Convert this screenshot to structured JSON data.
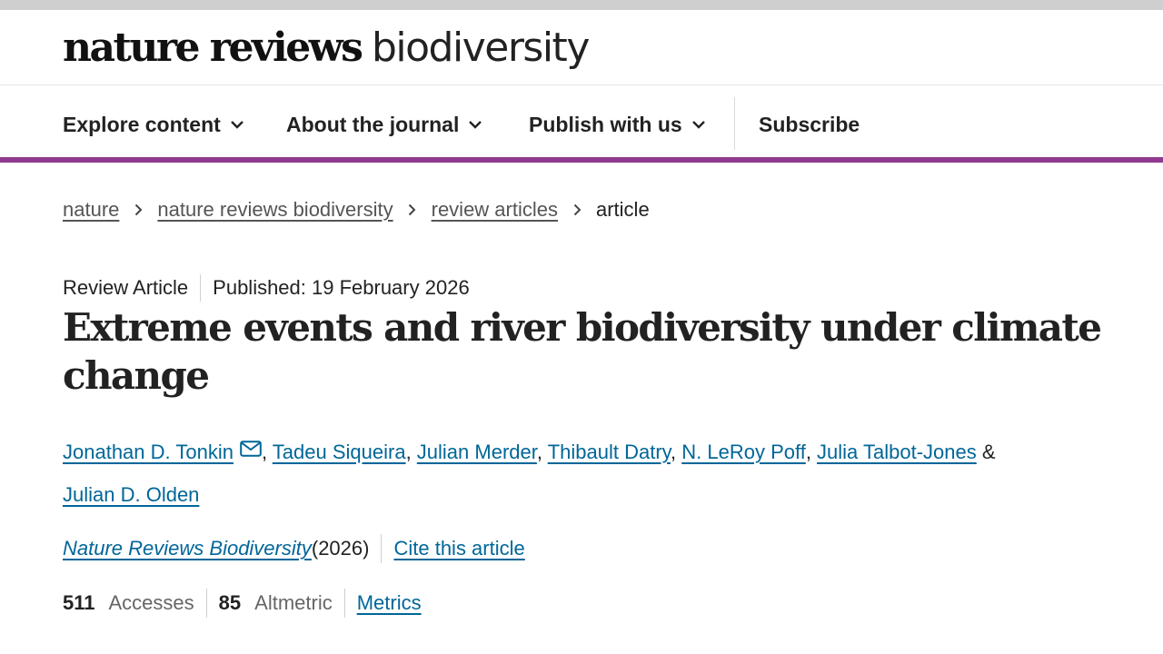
{
  "logo": {
    "bold": "nature reviews",
    "light": "biodiversity"
  },
  "nav": {
    "items": [
      {
        "label": "Explore content"
      },
      {
        "label": "About the journal"
      },
      {
        "label": "Publish with us"
      }
    ],
    "subscribe": "Subscribe"
  },
  "breadcrumb": {
    "items": [
      "nature",
      "nature reviews biodiversity",
      "review articles"
    ],
    "current": "article"
  },
  "article": {
    "type": "Review Article",
    "published": "Published: 19 February 2026",
    "title": "Extreme events and river biodiversity under climate change",
    "authors": [
      "Jonathan D. Tonkin",
      "Tadeu Siqueira",
      "Julian Merder",
      "Thibault Datry",
      "N. LeRoy Poff",
      "Julia Talbot-Jones",
      "Julian D. Olden"
    ],
    "author_sep": ", ",
    "and_text": " & ",
    "journal": "Nature Reviews Biodiversity",
    "year": " (2026)",
    "cite_label": "Cite this article"
  },
  "metrics": {
    "accesses_value": "511",
    "accesses_label": "Accesses",
    "altmetric_value": "85",
    "altmetric_label": "Altmetric",
    "metrics_link": "Metrics"
  },
  "icons": {
    "chevron": "chevron-down-icon",
    "breadcrumb_sep": "chevron-right-icon",
    "email": "email-icon"
  },
  "colors": {
    "accent": "#8f3a8e",
    "link": "#006699"
  }
}
